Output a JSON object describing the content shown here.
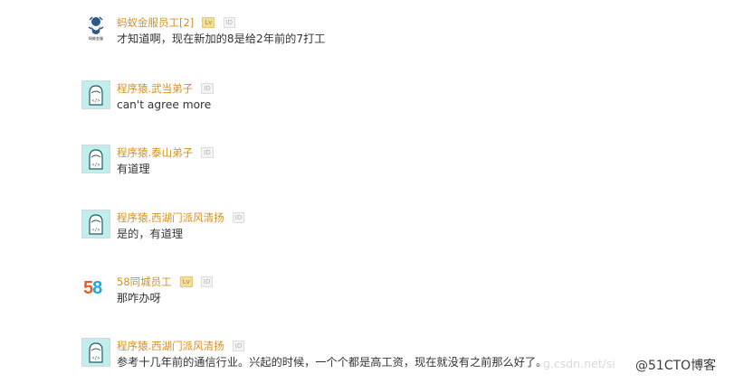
{
  "comments": [
    {
      "avatar_icon": "ant-financial-logo-icon",
      "avatar_caption": "蚂蚁金服",
      "username": "蚂蚁金服员工[2]",
      "badges": [
        "Lv",
        "ID"
      ],
      "text": "才知道啊，现在新加的8是给2年前的7打工"
    },
    {
      "avatar_icon": "coder-avatar-icon",
      "username": "程序猿.武当弟子",
      "badges": [
        "ID"
      ],
      "text": "can't agree more"
    },
    {
      "avatar_icon": "coder-avatar-icon",
      "username": "程序猿.泰山弟子",
      "badges": [
        "ID"
      ],
      "text": "有道理"
    },
    {
      "avatar_icon": "coder-avatar-icon",
      "username": "程序猿.西湖门派风清扬",
      "badges": [
        "ID"
      ],
      "text": "是的，有道理"
    },
    {
      "avatar_icon": "58-logo-icon",
      "avatar_logo_text": "58",
      "username": "58同城员工",
      "badges": [
        "Lv",
        "ID"
      ],
      "text": "那咋办呀"
    },
    {
      "avatar_icon": "coder-avatar-icon",
      "username": "程序猿.西湖门派风清扬",
      "badges": [
        "ID"
      ],
      "text": "参考十几年前的通信行业。兴起的时候，一个个都是高工资，现在就没有之前那么好了。"
    }
  ],
  "watermarks": {
    "faint": "g.csdn.net/si",
    "main": "@51CTO博客"
  },
  "colors": {
    "username": "#d49022",
    "text": "#333333",
    "coder_avatar_bg": "#bfeeee"
  }
}
